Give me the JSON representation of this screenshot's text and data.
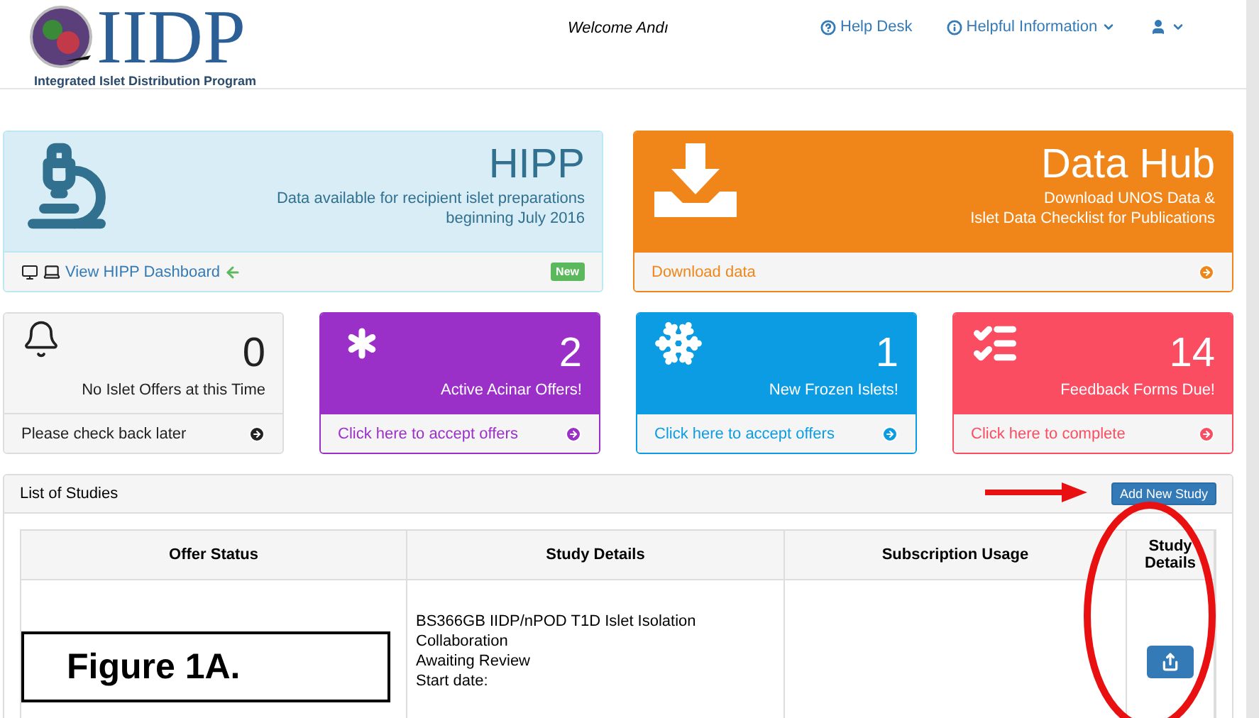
{
  "header": {
    "logo_text": "IIDP",
    "logo_subtitle": "Integrated Islet Distribution Program",
    "welcome": "Welcome Andı",
    "nav": [
      {
        "label": "Help Desk",
        "kind": "help"
      },
      {
        "label": "Helpful Information",
        "kind": "info"
      },
      {
        "kind": "user"
      }
    ]
  },
  "feature_cards": [
    {
      "kind": "hipp",
      "title": "HIPP",
      "lines": [
        "Data available for recipient islet preparations",
        "beginning July 2016"
      ],
      "link": "View HIPP Dashboard",
      "badge": "New"
    },
    {
      "kind": "datahub",
      "title": "Data Hub",
      "lines": [
        "Download UNOS Data &",
        "Islet Data Checklist for Publications"
      ],
      "link": "Download data"
    }
  ],
  "stat_cards": [
    {
      "kind": "bell",
      "color": "#f5f5f5",
      "count": "0",
      "label": "No Islet Offers at this Time",
      "link": "Please check back later"
    },
    {
      "kind": "asterisk",
      "color": "#9b30c8",
      "count": "2",
      "label": "Active Acinar Offers!",
      "link": "Click here to accept offers"
    },
    {
      "kind": "snowflake",
      "color": "#0b9ce3",
      "count": "1",
      "label": "New Frozen Islets!",
      "link": "Click here to accept offers"
    },
    {
      "kind": "checklist",
      "color": "#fb4d61",
      "count": "14",
      "label": "Feedback Forms Due!",
      "link": "Click here to complete"
    }
  ],
  "studies": {
    "title": "List of Studies",
    "add_button": "Add New Study",
    "columns": [
      "Offer Status",
      "Study Details",
      "Subscription Usage",
      "Study Details"
    ],
    "rows": [
      {
        "details": [
          "BS366GB IIDP/nPOD T1D Islet Isolation",
          "Collaboration",
          "Awaiting Review",
          "Start date:"
        ]
      }
    ]
  },
  "annotation": {
    "figure_label": "Figure 1A."
  }
}
